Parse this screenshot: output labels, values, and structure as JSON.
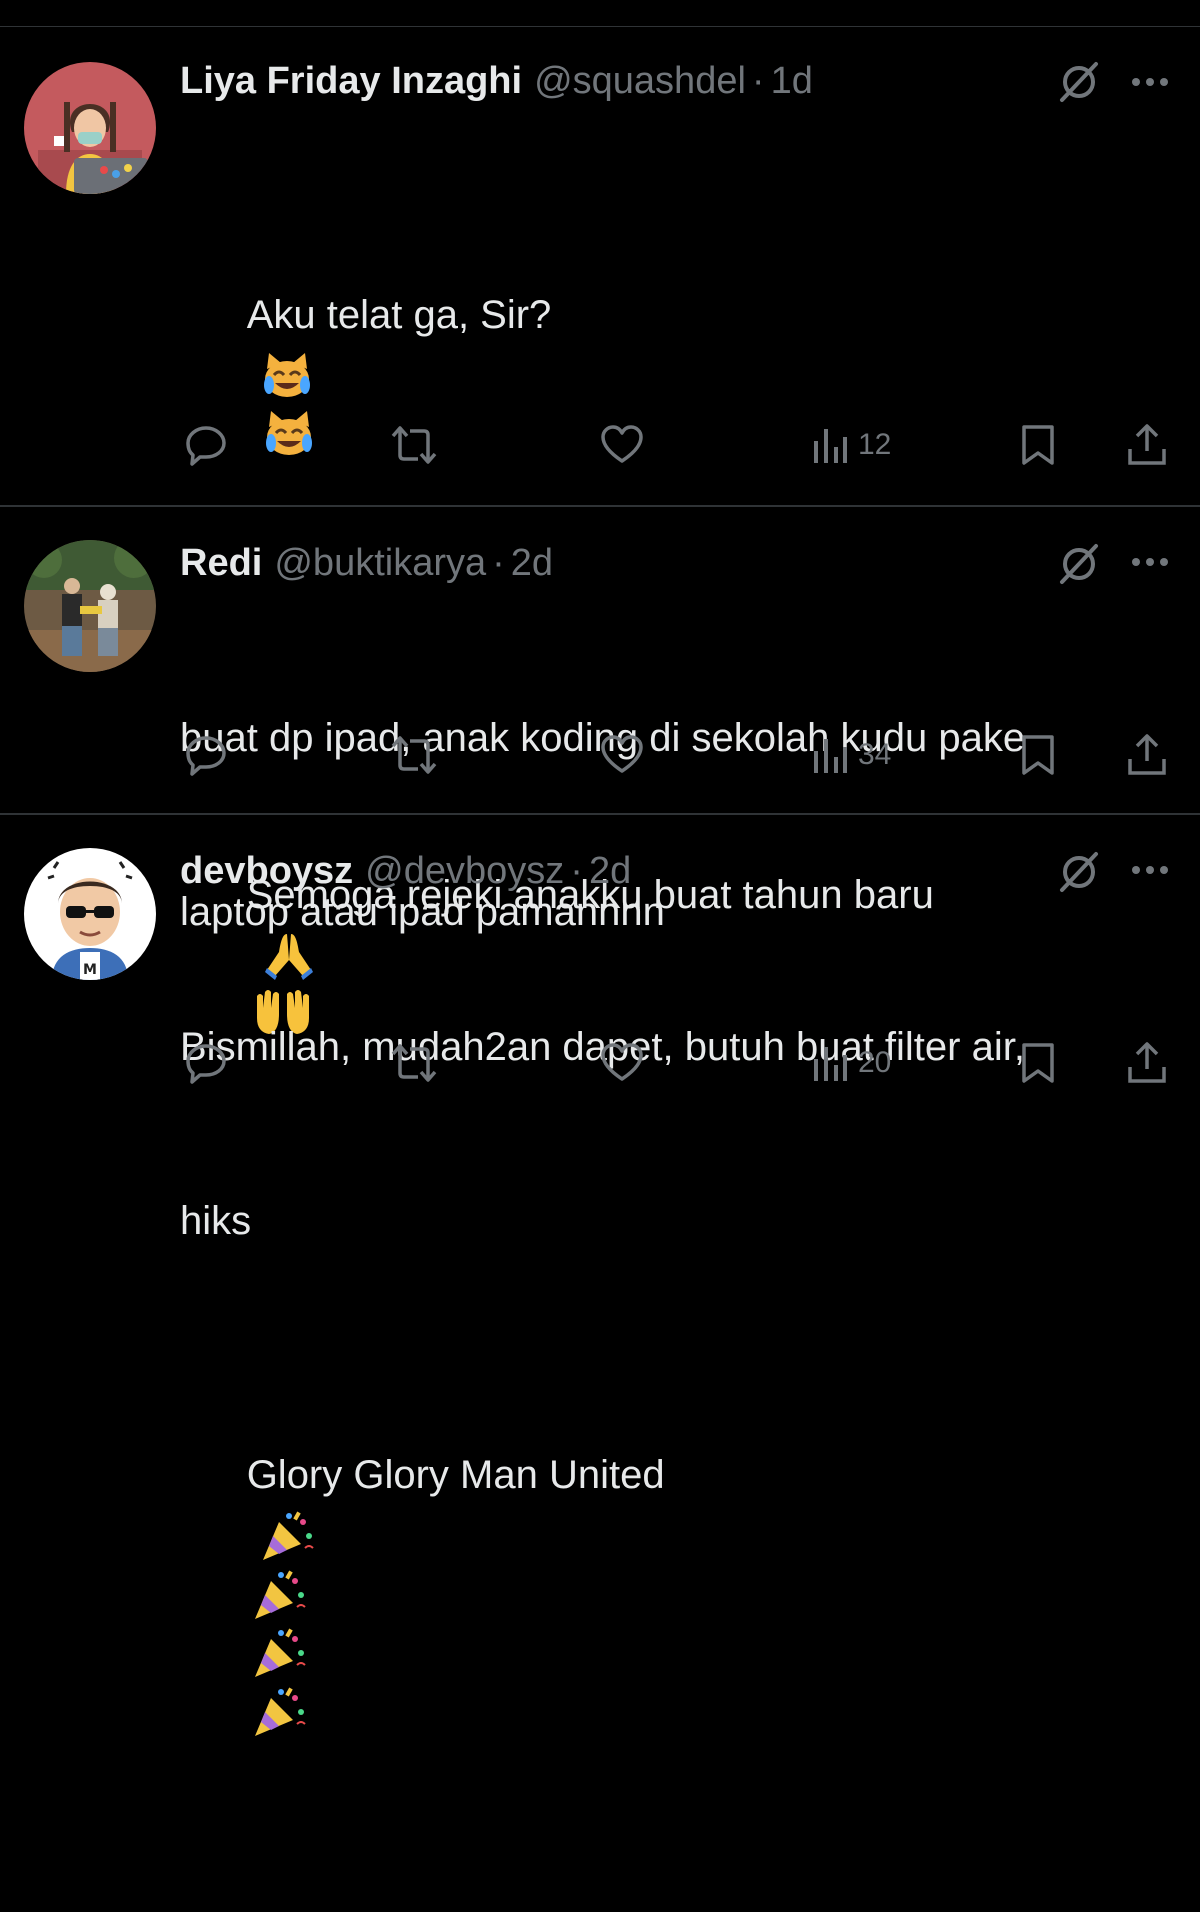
{
  "colors": {
    "background": "#000000",
    "primary_text": "#e7e9ea",
    "secondary_text": "#71767b",
    "divider": "#2f3336"
  },
  "tweets": [
    {
      "name": "Liya Friday Inzaghi",
      "handle": "@squashdel",
      "separator": "·",
      "time": "1d",
      "lines": [
        {
          "text": "Aku telat ga, Sir?",
          "emojis": [
            "cat-joy-emoji",
            "cat-joy-emoji"
          ]
        },
        {
          "text": "",
          "emojis": []
        },
        {
          "text": "Semoga rejeki anakku buat tahun baru",
          "emojis": [
            "folded-hands-emoji",
            "palms-up-emoji"
          ]
        },
        {
          "text": "",
          "emojis": []
        },
        {
          "text": "Glory Glory Man United",
          "emojis": [
            "party-popper-emoji",
            "party-popper-emoji",
            "party-popper-emoji",
            "party-popper-emoji"
          ]
        }
      ],
      "views": "12",
      "icons": [
        "reply-icon",
        "retweet-icon",
        "like-icon",
        "views-icon",
        "bookmark-icon",
        "share-icon",
        "grok-icon",
        "more-icon"
      ]
    },
    {
      "name": "Redi",
      "handle": "@buktikarya",
      "separator": "·",
      "time": "2d",
      "lines": [
        {
          "text": "buat dp ipad, anak koding di sekolah kudu pake",
          "emojis": []
        },
        {
          "text": "laptop atau ipad pamannnn",
          "emojis": []
        }
      ],
      "views": "34",
      "icons": [
        "reply-icon",
        "retweet-icon",
        "like-icon",
        "views-icon",
        "bookmark-icon",
        "share-icon",
        "grok-icon",
        "more-icon"
      ]
    },
    {
      "name": "devboysz",
      "handle": "@devboysz",
      "separator": "·",
      "time": "2d",
      "lines": [
        {
          "text": "Bismillah, mudah2an dapet, butuh buat filter air,",
          "emojis": []
        },
        {
          "text": "hiks",
          "emojis": []
        }
      ],
      "views": "20",
      "avatar_badge": "M",
      "icons": [
        "reply-icon",
        "retweet-icon",
        "like-icon",
        "views-icon",
        "bookmark-icon",
        "share-icon",
        "grok-icon",
        "more-icon"
      ]
    }
  ]
}
